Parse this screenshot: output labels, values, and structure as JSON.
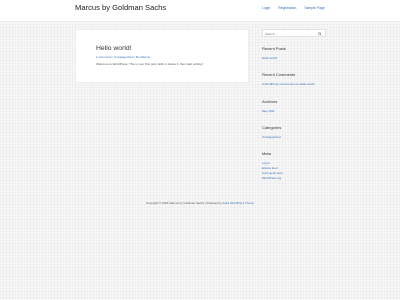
{
  "header": {
    "site_title": "Marcus by Goldman Sachs",
    "nav": [
      "Login",
      "Registration",
      "Sample Page"
    ]
  },
  "post": {
    "title": "Hello world!",
    "meta": {
      "comments": "1 Comment",
      "category": "Uncategorized",
      "author": "By Marcus"
    },
    "content": "Welcome to WordPress. This is your first post. Edit or delete it, then start writing!"
  },
  "sidebar": {
    "search_placeholder": "Search ...",
    "recent_posts": {
      "title": "Recent Posts",
      "items": [
        "Hello world!"
      ]
    },
    "recent_comments": {
      "title": "Recent Comments",
      "author": "A WordPress Commenter",
      "on": "on",
      "post": "Hello world!"
    },
    "archives": {
      "title": "Archives",
      "items": [
        "May 2021"
      ]
    },
    "categories": {
      "title": "Categories",
      "items": [
        "Uncategorized"
      ]
    },
    "meta": {
      "title": "Meta",
      "items": [
        "Log in",
        "Entries feed",
        "Comments feed",
        "WordPress.org"
      ]
    }
  },
  "footer": {
    "text": "Copyright © 2021 Marcus by Goldman Sachs | Powered by",
    "link": "Astra WordPress Theme"
  },
  "colors": {
    "link": "#3a6fb8",
    "background": "#f7f7f7"
  }
}
